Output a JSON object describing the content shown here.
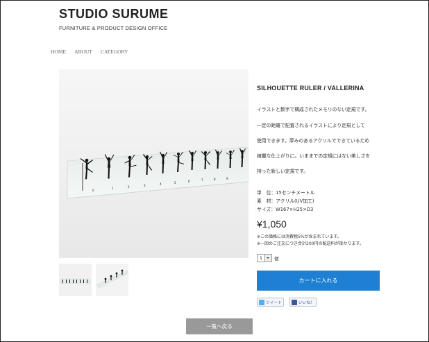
{
  "header": {
    "logo_title": "STUDIO SURUME",
    "logo_subtitle": "FURNITURE & PRODUCT DESIGN OFFICE"
  },
  "nav": [
    "HOME",
    "ABOUT",
    "CATEGORY"
  ],
  "product": {
    "title": "SILHOUETTE RULER / VALLERINA",
    "description": [
      "イラストと数字で構成されたメモリのない定規です。",
      "一定の距離で配置されるイラストにより定規として",
      "使用できます。厚みのあるアクリルでできているため",
      "綺麗な仕上がりに。いままでの定規にはない美しさを",
      "持った新しい定規です。"
    ],
    "specs": [
      "単　位：15センチメートル",
      "素　材：アクリル(UV加工)",
      "サイズ：W167×H25×D3"
    ],
    "price": "¥1,050",
    "notes": [
      "※この価格には消費税5%が含まれています。",
      "※一回のご注文につき合計200円の配送料が掛かります。"
    ],
    "quantity": "1",
    "quantity_unit": "個",
    "cart_label": "カートに入れる",
    "tweet_label": "ツイート",
    "like_label": "いいね！",
    "back_label": "一覧へ戻る"
  },
  "colors": {
    "cart_button": "#1e7fd3",
    "back_button": "#999999",
    "text": "#222222"
  }
}
